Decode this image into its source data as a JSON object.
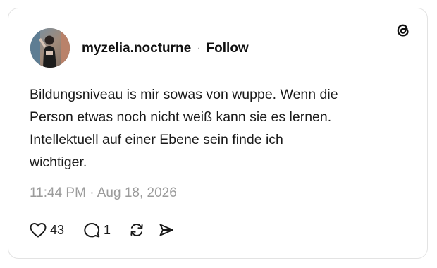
{
  "post": {
    "author": {
      "username": "myzelia.nocturne",
      "separator": "·",
      "follow_label": "Follow",
      "avatar_icon": "profile-photo"
    },
    "text_lines": [
      "Bildungsniveau is mir sowas von wuppe. Wenn die",
      "Person etwas noch nicht weiß kann sie es lernen.",
      "Intellektuell auf einer Ebene sein finde ich",
      "wichtiger."
    ],
    "timestamp": "11:44 PM · Aug 18, 2026",
    "actions": {
      "like": {
        "icon": "heart-icon",
        "count": "43"
      },
      "reply": {
        "icon": "comment-icon",
        "count": "1"
      },
      "repost": {
        "icon": "repost-icon"
      },
      "share": {
        "icon": "send-icon"
      }
    },
    "brand_icon": "threads-logo"
  },
  "colors": {
    "text": "#101010",
    "muted": "#9b9b9b",
    "border": "#e3e3e3",
    "background": "#ffffff"
  }
}
